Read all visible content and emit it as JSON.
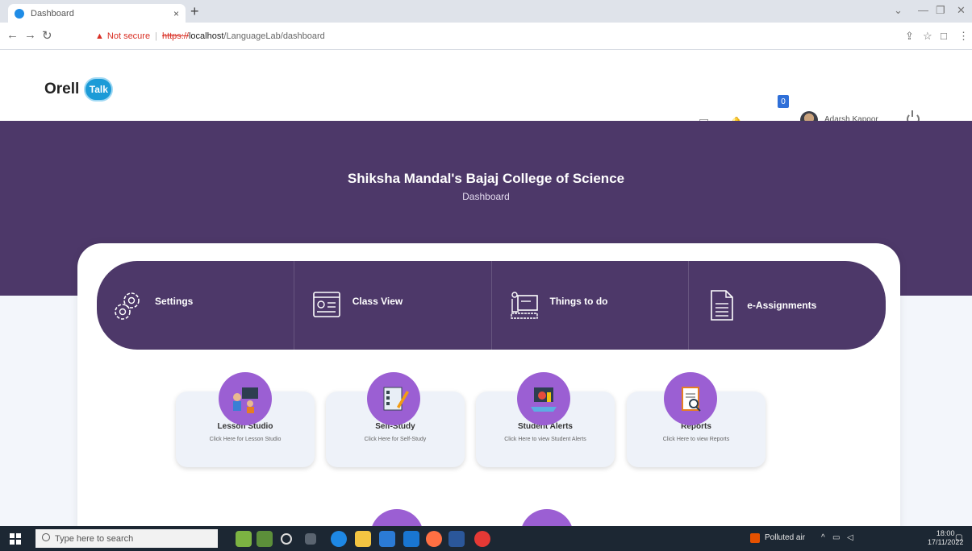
{
  "browser": {
    "tab_title": "Dashboard",
    "tab_close": "×",
    "new_tab": "+",
    "security_warning": "Not secure",
    "url_scheme": "https://",
    "url_host": "localhost",
    "url_path": "/LanguageLab/dashboard"
  },
  "app": {
    "logo_text": "Orell",
    "logo_badge": "Talk",
    "notification_count": "0",
    "user_name": "Adarsh Kapoor"
  },
  "hero": {
    "institution": "Shiksha Mandal's Bajaj College of Science",
    "page_name": "Dashboard"
  },
  "menu": [
    {
      "label": "Settings",
      "icon": "settings-gears-icon"
    },
    {
      "label": "Class View",
      "icon": "class-view-icon"
    },
    {
      "label": "Things to do",
      "icon": "things-to-do-icon"
    },
    {
      "label": "e-Assignments",
      "icon": "document-icon"
    }
  ],
  "tiles": [
    {
      "title": "Lesson Studio",
      "desc": "Click Here for Lesson Studio",
      "icon": "lesson-studio-icon"
    },
    {
      "title": "Self-Study",
      "desc": "Click Here for Self-Study",
      "icon": "self-study-icon"
    },
    {
      "title": "Student Alerts",
      "desc": "Click Here to view Student Alerts",
      "icon": "student-alerts-icon"
    },
    {
      "title": "Reports",
      "desc": "Click Here to view Reports",
      "icon": "reports-icon"
    }
  ],
  "taskbar": {
    "search_placeholder": "Type here to search",
    "weather": "Polluted air",
    "time": "18:00",
    "date": "17/11/2022"
  },
  "colors": {
    "primary_purple": "#4d3869",
    "tile_circle": "#9b5fd3",
    "logo_blue": "#1c9bd7"
  }
}
